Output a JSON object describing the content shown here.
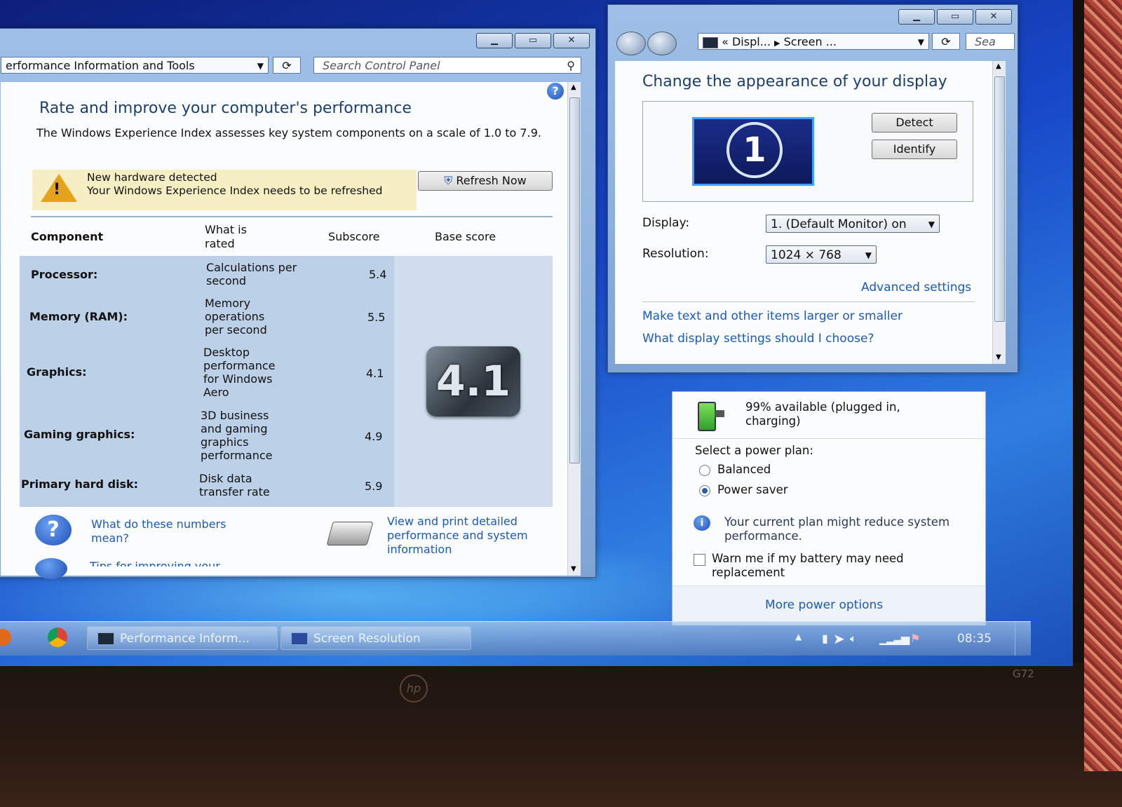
{
  "perf_window": {
    "address": "erformance Information and Tools",
    "search_placeholder": "Search Control Panel",
    "title": "Rate and improve your computer's performance",
    "description": "The Windows Experience Index assesses key system components on a scale of 1.0 to 7.9.",
    "banner": {
      "line1": "New hardware detected",
      "line2": "Your Windows Experience Index needs to be refreshed"
    },
    "refresh_label": "Refresh Now",
    "headers": {
      "component": "Component",
      "what": "What is rated",
      "subscore": "Subscore",
      "base": "Base score"
    },
    "rows": [
      {
        "component": "Processor:",
        "what": "Calculations per second",
        "subscore": "5.4"
      },
      {
        "component": "Memory (RAM):",
        "what": "Memory operations per second",
        "subscore": "5.5"
      },
      {
        "component": "Graphics:",
        "what": "Desktop performance for Windows Aero",
        "subscore": "4.1"
      },
      {
        "component": "Gaming graphics:",
        "what": "3D business and gaming graphics performance",
        "subscore": "4.9"
      },
      {
        "component": "Primary hard disk:",
        "what": "Disk data transfer rate",
        "subscore": "5.9"
      }
    ],
    "base_score": "4.1",
    "links": {
      "numbers": "What do these numbers mean?",
      "print": "View and print detailed performance and system information",
      "tips": "Tips for improving your"
    }
  },
  "display_window": {
    "breadcrumb": [
      "«",
      "Displ...",
      "Screen ..."
    ],
    "search": "Sea",
    "title": "Change the appearance of your display",
    "detect_label": "Detect",
    "identify_label": "Identify",
    "monitor_number": "1",
    "display_label": "Display:",
    "display_value": "1. (Default Monitor) on",
    "resolution_label": "Resolution:",
    "resolution_value": "1024 × 768",
    "advanced": "Advanced settings",
    "link1": "Make text and other items larger or smaller",
    "link2": "What display settings should I choose?"
  },
  "power_popup": {
    "status": "99% available (plugged in, charging)",
    "select_label": "Select a power plan:",
    "plans": [
      {
        "label": "Balanced",
        "selected": false
      },
      {
        "label": "Power saver",
        "selected": true
      }
    ],
    "info": "Your current plan might reduce system performance.",
    "warn_label": "Warn me if my battery may need replacement",
    "more": "More power options"
  },
  "taskbar": {
    "items": [
      "Performance Inform...",
      "Screen Resolution"
    ],
    "clock": "08:35"
  },
  "laptop": {
    "model": "G72",
    "brand": "hp"
  }
}
